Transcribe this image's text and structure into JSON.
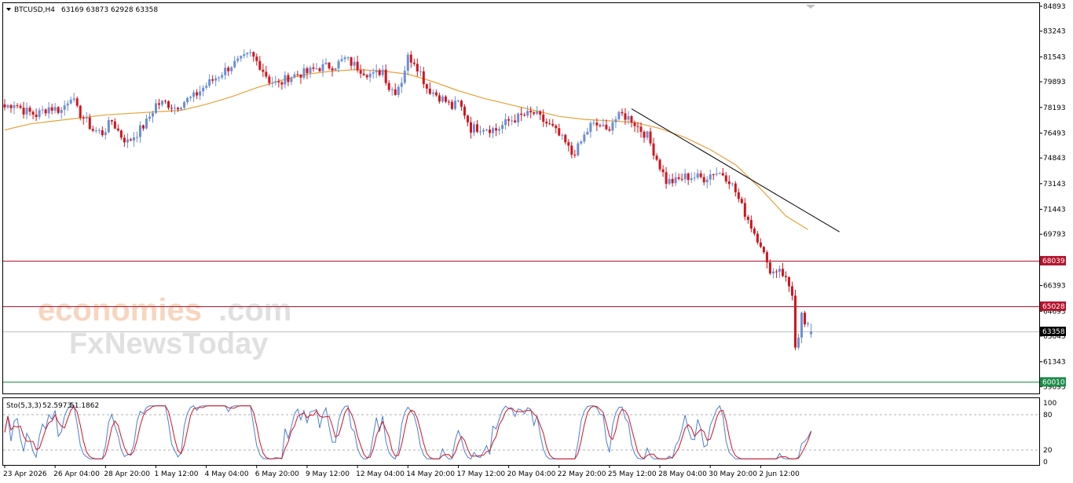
{
  "header": {
    "symbol": "BTCUSD,H4",
    "ohlc": "63169 63873 62928 63358"
  },
  "watermark": {
    "line1_left": "economies",
    "line1_right": ".com",
    "line2_a": "Fx",
    "line2_b": "NewsToday"
  },
  "colors": {
    "bull": "#6b8fd6",
    "bear": "#d4141c",
    "ma": "#e8a23a",
    "resistance": "#b3132b",
    "support": "#1e8c4a",
    "current_line": "#c0c0c0",
    "trendline": "#000000",
    "stoch_main": "#4a7fd6",
    "stoch_signal": "#d4141c"
  },
  "chart_data": {
    "type": "candlestick",
    "title": "BTCUSD,H4",
    "ohlc_last": {
      "open": 63169,
      "high": 63873,
      "low": 62928,
      "close": 63358
    },
    "ylim": [
      59400,
      84893
    ],
    "y_ticks": [
      84893,
      83243,
      81543,
      79893,
      78193,
      76493,
      74843,
      73143,
      71443,
      69793,
      66393,
      64693,
      63043,
      61343,
      59693
    ],
    "x_tick_labels": [
      "23 Apr 2026",
      "26 Apr 04:00",
      "28 Apr 20:00",
      "1 May 12:00",
      "4 May 04:00",
      "6 May 20:00",
      "9 May 12:00",
      "12 May 04:00",
      "14 May 20:00",
      "17 May 12:00",
      "20 May 04:00",
      "22 May 20:00",
      "25 May 12:00",
      "28 May 04:00",
      "30 May 20:00",
      "2 Jun 12:00"
    ],
    "x_tick_positions": [
      0,
      16,
      32,
      48,
      64,
      80,
      96,
      112,
      128,
      144,
      160,
      176,
      192,
      208,
      224,
      240
    ],
    "price_levels": [
      {
        "label": "68039",
        "value": 68039,
        "kind": "resistance"
      },
      {
        "label": "65028",
        "value": 65028,
        "kind": "resistance"
      },
      {
        "label": "63358",
        "value": 63358,
        "kind": "current"
      },
      {
        "label": "60010",
        "value": 60010,
        "kind": "support"
      }
    ],
    "trendline": {
      "from": {
        "bar": 199,
        "price": 78100
      },
      "to": {
        "bar": 265,
        "price": 69950
      }
    },
    "moving_average": [
      [
        0,
        76700
      ],
      [
        8,
        77100
      ],
      [
        16,
        77300
      ],
      [
        24,
        77500
      ],
      [
        32,
        77700
      ],
      [
        40,
        77800
      ],
      [
        48,
        77900
      ],
      [
        56,
        78000
      ],
      [
        64,
        78400
      ],
      [
        72,
        78900
      ],
      [
        80,
        79500
      ],
      [
        88,
        80000
      ],
      [
        96,
        80400
      ],
      [
        104,
        80600
      ],
      [
        112,
        80700
      ],
      [
        120,
        80600
      ],
      [
        128,
        80400
      ],
      [
        136,
        79900
      ],
      [
        144,
        79300
      ],
      [
        152,
        78800
      ],
      [
        160,
        78400
      ],
      [
        168,
        78000
      ],
      [
        176,
        77600
      ],
      [
        184,
        77400
      ],
      [
        192,
        77300
      ],
      [
        200,
        77200
      ],
      [
        208,
        76800
      ],
      [
        216,
        76200
      ],
      [
        224,
        75400
      ],
      [
        232,
        74400
      ],
      [
        240,
        72800
      ],
      [
        248,
        71000
      ],
      [
        255,
        70100
      ]
    ],
    "price_path": [
      [
        0,
        78200
      ],
      [
        3,
        78500
      ],
      [
        6,
        78000
      ],
      [
        10,
        77700
      ],
      [
        14,
        78200
      ],
      [
        18,
        78000
      ],
      [
        21,
        79000
      ],
      [
        23,
        78000
      ],
      [
        25,
        77500
      ],
      [
        28,
        76700
      ],
      [
        31,
        76500
      ],
      [
        34,
        77300
      ],
      [
        37,
        76300
      ],
      [
        39,
        75900
      ],
      [
        42,
        76500
      ],
      [
        45,
        77200
      ],
      [
        48,
        78400
      ],
      [
        51,
        78500
      ],
      [
        54,
        78200
      ],
      [
        57,
        78600
      ],
      [
        60,
        78900
      ],
      [
        63,
        79500
      ],
      [
        66,
        80000
      ],
      [
        69,
        80500
      ],
      [
        72,
        81000
      ],
      [
        75,
        81300
      ],
      [
        78,
        81700
      ],
      [
        81,
        81000
      ],
      [
        84,
        80000
      ],
      [
        87,
        79700
      ],
      [
        90,
        80200
      ],
      [
        93,
        80400
      ],
      [
        96,
        80500
      ],
      [
        99,
        80800
      ],
      [
        102,
        80900
      ],
      [
        105,
        81000
      ],
      [
        108,
        81400
      ],
      [
        111,
        81000
      ],
      [
        114,
        80600
      ],
      [
        117,
        80300
      ],
      [
        120,
        80700
      ],
      [
        122,
        79500
      ],
      [
        124,
        79300
      ],
      [
        126,
        80000
      ],
      [
        128,
        81500
      ],
      [
        130,
        81300
      ],
      [
        132,
        80500
      ],
      [
        134,
        79500
      ],
      [
        136,
        79200
      ],
      [
        138,
        78900
      ],
      [
        140,
        78600
      ],
      [
        142,
        78200
      ],
      [
        144,
        78500
      ],
      [
        146,
        77800
      ],
      [
        148,
        76800
      ],
      [
        152,
        76900
      ],
      [
        156,
        76700
      ],
      [
        160,
        77300
      ],
      [
        164,
        77600
      ],
      [
        168,
        77800
      ],
      [
        171,
        77300
      ],
      [
        174,
        76800
      ],
      [
        176,
        76300
      ],
      [
        178,
        75800
      ],
      [
        180,
        75100
      ],
      [
        182,
        75500
      ],
      [
        184,
        76300
      ],
      [
        186,
        77000
      ],
      [
        189,
        77000
      ],
      [
        191,
        76600
      ],
      [
        193,
        77300
      ],
      [
        196,
        77700
      ],
      [
        199,
        77400
      ],
      [
        201,
        76900
      ],
      [
        204,
        76300
      ],
      [
        206,
        75300
      ],
      [
        208,
        74300
      ],
      [
        210,
        73300
      ],
      [
        213,
        73300
      ],
      [
        216,
        73600
      ],
      [
        219,
        73600
      ],
      [
        222,
        73500
      ],
      [
        225,
        73900
      ],
      [
        228,
        73800
      ],
      [
        230,
        73400
      ],
      [
        232,
        72600
      ],
      [
        234,
        71600
      ],
      [
        236,
        70800
      ],
      [
        238,
        69900
      ],
      [
        240,
        69200
      ],
      [
        242,
        67700
      ],
      [
        244,
        67300
      ],
      [
        246,
        67600
      ],
      [
        248,
        66800
      ],
      [
        250,
        65900
      ],
      [
        251,
        62200
      ],
      [
        252,
        62700
      ],
      [
        253,
        64300
      ],
      [
        254,
        63900
      ],
      [
        255,
        63600
      ],
      [
        256,
        63358
      ]
    ],
    "stochastic": {
      "name": "Sto(5,3,3)",
      "main_label": "52.5973",
      "signal_label": "51.1862",
      "main": 52.5973,
      "signal": 51.1862,
      "levels": [
        0,
        20,
        80,
        100
      ],
      "scale_labels": [
        "100",
        "80",
        "20",
        "0"
      ]
    },
    "y_axis_side": "right",
    "grid": false
  }
}
